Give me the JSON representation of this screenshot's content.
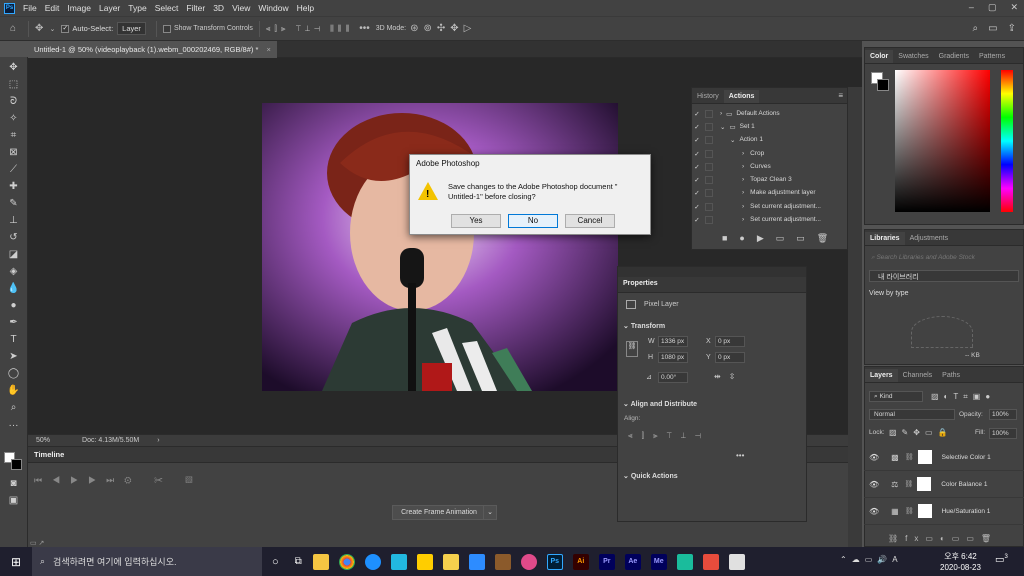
{
  "menubar": {
    "logo": "Ps",
    "items": [
      "File",
      "Edit",
      "Image",
      "Layer",
      "Type",
      "Select",
      "Filter",
      "3D",
      "View",
      "Window",
      "Help"
    ]
  },
  "options": {
    "auto_select_label": "Auto-Select:",
    "auto_select_value": "Layer",
    "show_transform_label": "Show Transform Controls",
    "mode_3d_label": "3D Mode:"
  },
  "document": {
    "tab_title": "Untitled-1 @ 50% (videoplayback (1).webm_000202469, RGB/8#) *",
    "zoom": "50%",
    "doc_size": "Doc: 4.13M/5.50M"
  },
  "dialog": {
    "title": "Adobe Photoshop",
    "message_line1": "Save changes to the Adobe Photoshop document \"",
    "message_line2": "Untitled-1\" before closing?",
    "yes": "Yes",
    "no": "No",
    "cancel": "Cancel"
  },
  "actions_panel": {
    "tabs": [
      "History",
      "Actions"
    ],
    "rows": [
      "Default Actions",
      "Set 1",
      "Action 1",
      "Crop",
      "Curves",
      "Topaz Clean 3",
      "Make adjustment layer",
      "Set current adjustment...",
      "Set current adjustment..."
    ]
  },
  "color_panel": {
    "tabs": [
      "Color",
      "Swatches",
      "Gradients",
      "Patterns"
    ]
  },
  "libraries_panel": {
    "tabs": [
      "Libraries",
      "Adjustments"
    ],
    "search_placeholder": "Search Libraries and Adobe Stock",
    "library_name": "내 라이브러리",
    "view_by": "View by type",
    "size": "-- KB"
  },
  "properties_panel": {
    "title": "Properties",
    "pixel_layer": "Pixel Layer",
    "transform": "Transform",
    "w_label": "W",
    "w_value": "1336 px",
    "h_label": "H",
    "h_value": "1080 px",
    "x_label": "X",
    "x_value": "0 px",
    "y_label": "Y",
    "y_value": "0 px",
    "angle": "0.00°",
    "align_distribute": "Align and Distribute",
    "align": "Align:",
    "quick_actions": "Quick Actions"
  },
  "layers_panel": {
    "tabs": [
      "Layers",
      "Channels",
      "Paths"
    ],
    "kind": "Kind",
    "blend": "Normal",
    "opacity_label": "Opacity:",
    "opacity": "100%",
    "lock_label": "Lock:",
    "fill_label": "Fill:",
    "fill": "100%",
    "layers": [
      "Selective Color 1",
      "Color Balance 1",
      "Hue/Saturation 1"
    ]
  },
  "timeline": {
    "title": "Timeline",
    "create_button": "Create Frame Animation"
  },
  "taskbar": {
    "search_placeholder": "검색하려면 여기에 입력하십시오.",
    "time": "오후 6:42",
    "date": "2020-08-23",
    "notification_count": "3"
  },
  "colors": {
    "accent": "#31a8ff",
    "warning": "#f3c300"
  }
}
